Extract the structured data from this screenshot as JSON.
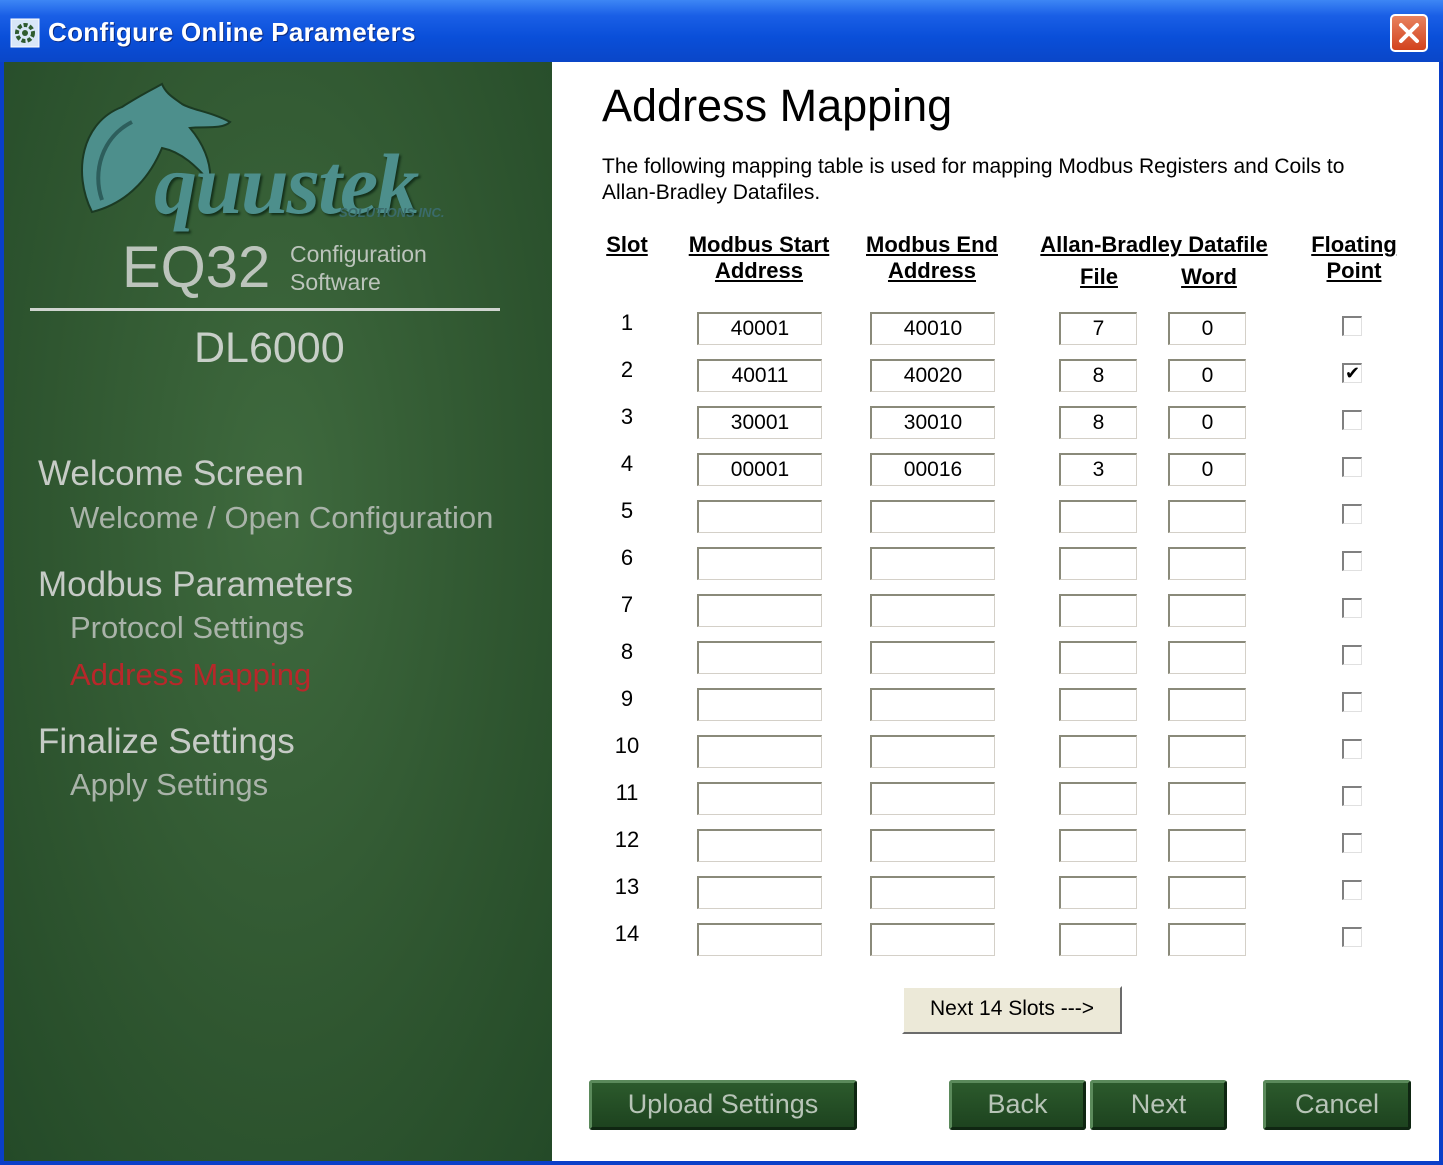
{
  "window": {
    "title": "Configure Online Parameters",
    "icon": "gear-app-icon",
    "close": "close-icon"
  },
  "sidebar": {
    "logo_text": "quustek",
    "logo_sub": "SOLUTIONS INC.",
    "eq32": "EQ32",
    "config_line1": "Configuration",
    "config_line2": "Software",
    "model": "DL6000",
    "sections": [
      {
        "heading": "Welcome Screen",
        "items": [
          "Welcome / Open Configuration"
        ]
      },
      {
        "heading": "Modbus Parameters",
        "items": [
          "Protocol Settings",
          "Address Mapping"
        ]
      },
      {
        "heading": "Finalize Settings",
        "items": [
          "Apply Settings"
        ]
      }
    ],
    "active_item": "Address Mapping",
    "active_color": "#b8272a"
  },
  "main": {
    "heading": "Address Mapping",
    "desc_line1": "The following mapping table is used for mapping Modbus Registers and Coils to",
    "desc_line2": "Allan-Bradley Datafiles.",
    "headers": {
      "slot": "Slot",
      "mb_start_1": "Modbus Start",
      "mb_start_2": "Address",
      "mb_end_1": "Modbus End",
      "mb_end_2": "Address",
      "ab": "Allan-Bradley Datafile",
      "file": "File",
      "word": "Word",
      "fp_1": "Floating",
      "fp_2": "Point"
    },
    "rows": [
      {
        "slot": "1",
        "start": "40001",
        "end": "40010",
        "file": "7",
        "word": "0",
        "fp": false
      },
      {
        "slot": "2",
        "start": "40011",
        "end": "40020",
        "file": "8",
        "word": "0",
        "fp": true
      },
      {
        "slot": "3",
        "start": "30001",
        "end": "30010",
        "file": "8",
        "word": "0",
        "fp": false
      },
      {
        "slot": "4",
        "start": "00001",
        "end": "00016",
        "file": "3",
        "word": "0",
        "fp": false
      },
      {
        "slot": "5",
        "start": "",
        "end": "",
        "file": "",
        "word": "",
        "fp": false
      },
      {
        "slot": "6",
        "start": "",
        "end": "",
        "file": "",
        "word": "",
        "fp": false
      },
      {
        "slot": "7",
        "start": "",
        "end": "",
        "file": "",
        "word": "",
        "fp": false
      },
      {
        "slot": "8",
        "start": "",
        "end": "",
        "file": "",
        "word": "",
        "fp": false
      },
      {
        "slot": "9",
        "start": "",
        "end": "",
        "file": "",
        "word": "",
        "fp": false
      },
      {
        "slot": "10",
        "start": "",
        "end": "",
        "file": "",
        "word": "",
        "fp": false
      },
      {
        "slot": "11",
        "start": "",
        "end": "",
        "file": "",
        "word": "",
        "fp": false
      },
      {
        "slot": "12",
        "start": "",
        "end": "",
        "file": "",
        "word": "",
        "fp": false
      },
      {
        "slot": "13",
        "start": "",
        "end": "",
        "file": "",
        "word": "",
        "fp": false
      },
      {
        "slot": "14",
        "start": "",
        "end": "",
        "file": "",
        "word": "",
        "fp": false
      }
    ],
    "next_slots_label": "Next 14 Slots --->",
    "buttons": {
      "upload": "Upload Settings",
      "back": "Back",
      "next": "Next",
      "cancel": "Cancel"
    }
  }
}
